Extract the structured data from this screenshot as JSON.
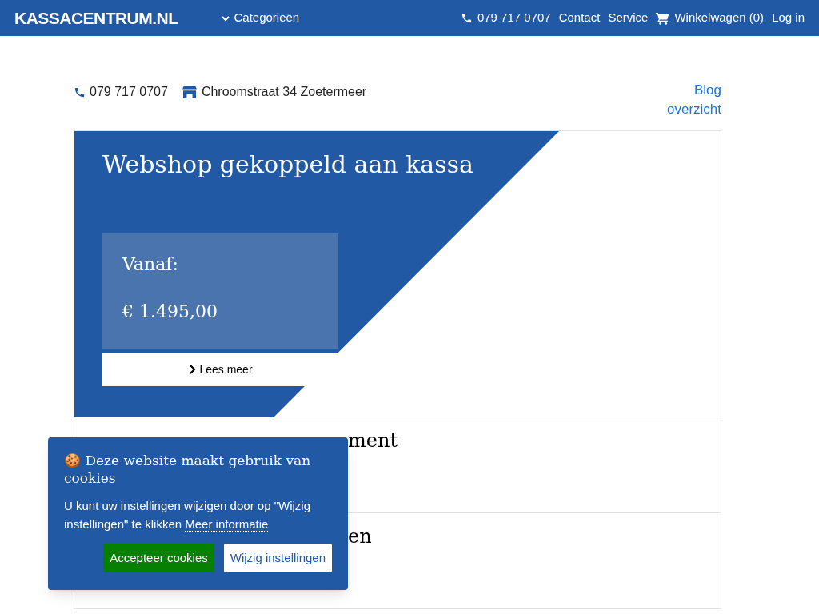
{
  "nav": {
    "logo": "KASSACENTRUM.NL",
    "menu": "Categorieën",
    "phone": "079 717 0707",
    "links": [
      "Contact",
      "Service"
    ],
    "cart": "Winkelwagen (0)",
    "login": "Log in"
  },
  "info": {
    "phone": "079 717 0707",
    "address": "Chroomstraat 34 Zoetermeer",
    "blog_link": "Blog overzicht"
  },
  "hero": {
    "title": "Webshop gekoppeld aan kassa",
    "price_label": "Vanaf:",
    "price": "€ 1.495,00",
    "button": "Lees meer"
  },
  "cards": [
    {
      "title_visible": "ment"
    },
    {
      "title_visible": "en"
    }
  ],
  "cookie": {
    "title": "🍪 Deze website maakt gebruik van cookies",
    "text": "U kunt uw instellingen wijzigen door op \"Wijzig instellingen\" te klikken",
    "link": "Meer informatie",
    "accept": "Accepteer cookies",
    "settings": "Wijzig instellingen"
  }
}
